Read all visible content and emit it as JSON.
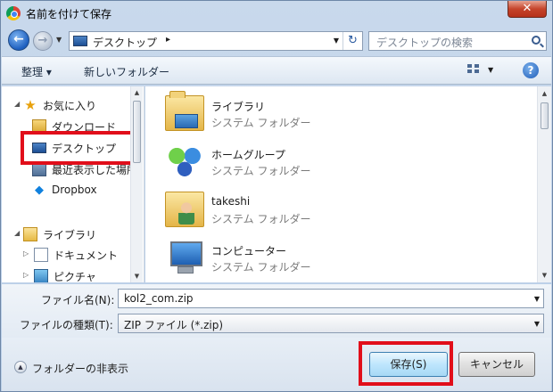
{
  "window": {
    "title": "名前を付けて保存",
    "close_label": "✕"
  },
  "address_bar": {
    "location": "デスクトップ",
    "separator": "▸",
    "search_placeholder": "デスクトップの検索"
  },
  "toolbar": {
    "organize": "整理 ▾",
    "new_folder": "新しいフォルダー",
    "help": "?"
  },
  "nav_pane": {
    "favorites": "お気に入り",
    "favorites_items": [
      "ダウンロード",
      "デスクトップ",
      "最近表示した場所",
      "Dropbox"
    ],
    "libraries": "ライブラリ",
    "library_items": [
      "ドキュメント",
      "ピクチャ"
    ],
    "selected": "デスクトップ"
  },
  "items": [
    {
      "name": "ライブラリ",
      "type": "システム フォルダー",
      "icon": "library-folder-icon"
    },
    {
      "name": "ホームグループ",
      "type": "システム フォルダー",
      "icon": "homegroup-icon"
    },
    {
      "name": "takeshi",
      "type": "システム フォルダー",
      "icon": "user-folder-icon"
    },
    {
      "name": "コンピューター",
      "type": "システム フォルダー",
      "icon": "computer-icon"
    }
  ],
  "form": {
    "filename_label": "ファイル名(N):",
    "filename_value": "kol2_com.zip",
    "filetype_label": "ファイルの種類(T):",
    "filetype_value": "ZIP ファイル (*.zip)"
  },
  "bottom": {
    "hide_folders": "フォルダーの非表示",
    "save": "保存(S)",
    "cancel": "キャンセル"
  },
  "colors": {
    "highlight_box": "#e10e1a",
    "window_frame": "#b8cde6"
  }
}
